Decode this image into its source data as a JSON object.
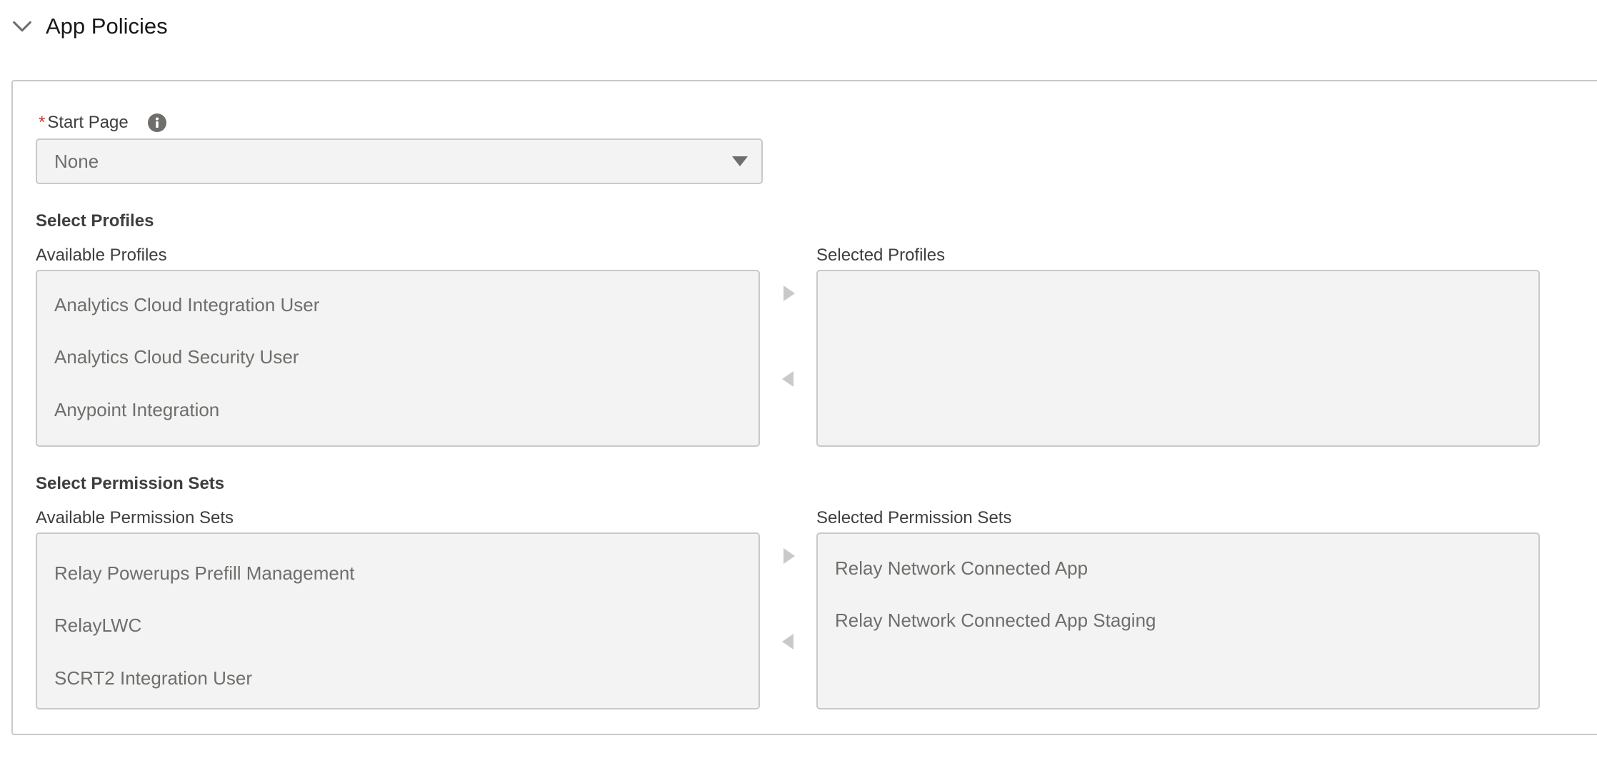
{
  "section": {
    "title": "App Policies",
    "icon": "chevron-down-icon"
  },
  "start_page": {
    "required_marker": "*",
    "label": "Start Page",
    "info_icon": "info-icon",
    "value": "None"
  },
  "profiles": {
    "group_title": "Select Profiles",
    "available_label": "Available Profiles",
    "selected_label": "Selected Profiles",
    "available": [
      {
        "label": "Analytics Cloud Integration User"
      },
      {
        "label": "Analytics Cloud Security User"
      },
      {
        "label": "Anypoint Integration"
      }
    ],
    "selected": []
  },
  "permission_sets": {
    "group_title": "Select Permission Sets",
    "available_label": "Available Permission Sets",
    "selected_label": "Selected Permission Sets",
    "available": [
      {
        "label": "Relay Powerups Prefill Management"
      },
      {
        "label": "RelayLWC"
      },
      {
        "label": "SCRT2 Integration User"
      }
    ],
    "selected": [
      {
        "label": "Relay Network Connected App"
      },
      {
        "label": "Relay Network Connected App Staging"
      }
    ]
  },
  "colors": {
    "required": "#c23934",
    "field_bg": "#f3f3f3",
    "border": "#c9c9c9",
    "muted_text": "#706e6b",
    "arrow": "#c9c9c9"
  }
}
